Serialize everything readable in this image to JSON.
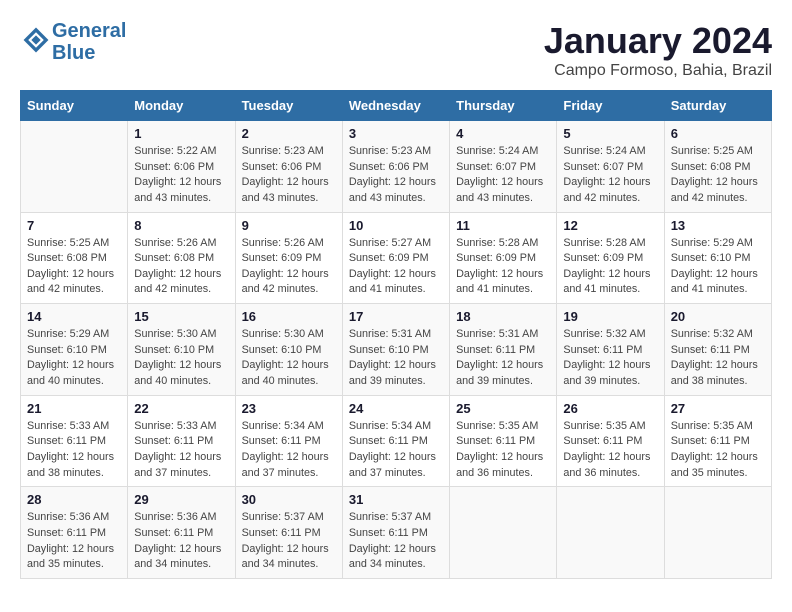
{
  "header": {
    "logo_line1": "General",
    "logo_line2": "Blue",
    "title": "January 2024",
    "subtitle": "Campo Formoso, Bahia, Brazil"
  },
  "calendar": {
    "days_of_week": [
      "Sunday",
      "Monday",
      "Tuesday",
      "Wednesday",
      "Thursday",
      "Friday",
      "Saturday"
    ],
    "weeks": [
      [
        {
          "day": "",
          "info": ""
        },
        {
          "day": "1",
          "info": "Sunrise: 5:22 AM\nSunset: 6:06 PM\nDaylight: 12 hours\nand 43 minutes."
        },
        {
          "day": "2",
          "info": "Sunrise: 5:23 AM\nSunset: 6:06 PM\nDaylight: 12 hours\nand 43 minutes."
        },
        {
          "day": "3",
          "info": "Sunrise: 5:23 AM\nSunset: 6:06 PM\nDaylight: 12 hours\nand 43 minutes."
        },
        {
          "day": "4",
          "info": "Sunrise: 5:24 AM\nSunset: 6:07 PM\nDaylight: 12 hours\nand 43 minutes."
        },
        {
          "day": "5",
          "info": "Sunrise: 5:24 AM\nSunset: 6:07 PM\nDaylight: 12 hours\nand 42 minutes."
        },
        {
          "day": "6",
          "info": "Sunrise: 5:25 AM\nSunset: 6:08 PM\nDaylight: 12 hours\nand 42 minutes."
        }
      ],
      [
        {
          "day": "7",
          "info": "Sunrise: 5:25 AM\nSunset: 6:08 PM\nDaylight: 12 hours\nand 42 minutes."
        },
        {
          "day": "8",
          "info": "Sunrise: 5:26 AM\nSunset: 6:08 PM\nDaylight: 12 hours\nand 42 minutes."
        },
        {
          "day": "9",
          "info": "Sunrise: 5:26 AM\nSunset: 6:09 PM\nDaylight: 12 hours\nand 42 minutes."
        },
        {
          "day": "10",
          "info": "Sunrise: 5:27 AM\nSunset: 6:09 PM\nDaylight: 12 hours\nand 41 minutes."
        },
        {
          "day": "11",
          "info": "Sunrise: 5:28 AM\nSunset: 6:09 PM\nDaylight: 12 hours\nand 41 minutes."
        },
        {
          "day": "12",
          "info": "Sunrise: 5:28 AM\nSunset: 6:09 PM\nDaylight: 12 hours\nand 41 minutes."
        },
        {
          "day": "13",
          "info": "Sunrise: 5:29 AM\nSunset: 6:10 PM\nDaylight: 12 hours\nand 41 minutes."
        }
      ],
      [
        {
          "day": "14",
          "info": "Sunrise: 5:29 AM\nSunset: 6:10 PM\nDaylight: 12 hours\nand 40 minutes."
        },
        {
          "day": "15",
          "info": "Sunrise: 5:30 AM\nSunset: 6:10 PM\nDaylight: 12 hours\nand 40 minutes."
        },
        {
          "day": "16",
          "info": "Sunrise: 5:30 AM\nSunset: 6:10 PM\nDaylight: 12 hours\nand 40 minutes."
        },
        {
          "day": "17",
          "info": "Sunrise: 5:31 AM\nSunset: 6:10 PM\nDaylight: 12 hours\nand 39 minutes."
        },
        {
          "day": "18",
          "info": "Sunrise: 5:31 AM\nSunset: 6:11 PM\nDaylight: 12 hours\nand 39 minutes."
        },
        {
          "day": "19",
          "info": "Sunrise: 5:32 AM\nSunset: 6:11 PM\nDaylight: 12 hours\nand 39 minutes."
        },
        {
          "day": "20",
          "info": "Sunrise: 5:32 AM\nSunset: 6:11 PM\nDaylight: 12 hours\nand 38 minutes."
        }
      ],
      [
        {
          "day": "21",
          "info": "Sunrise: 5:33 AM\nSunset: 6:11 PM\nDaylight: 12 hours\nand 38 minutes."
        },
        {
          "day": "22",
          "info": "Sunrise: 5:33 AM\nSunset: 6:11 PM\nDaylight: 12 hours\nand 37 minutes."
        },
        {
          "day": "23",
          "info": "Sunrise: 5:34 AM\nSunset: 6:11 PM\nDaylight: 12 hours\nand 37 minutes."
        },
        {
          "day": "24",
          "info": "Sunrise: 5:34 AM\nSunset: 6:11 PM\nDaylight: 12 hours\nand 37 minutes."
        },
        {
          "day": "25",
          "info": "Sunrise: 5:35 AM\nSunset: 6:11 PM\nDaylight: 12 hours\nand 36 minutes."
        },
        {
          "day": "26",
          "info": "Sunrise: 5:35 AM\nSunset: 6:11 PM\nDaylight: 12 hours\nand 36 minutes."
        },
        {
          "day": "27",
          "info": "Sunrise: 5:35 AM\nSunset: 6:11 PM\nDaylight: 12 hours\nand 35 minutes."
        }
      ],
      [
        {
          "day": "28",
          "info": "Sunrise: 5:36 AM\nSunset: 6:11 PM\nDaylight: 12 hours\nand 35 minutes."
        },
        {
          "day": "29",
          "info": "Sunrise: 5:36 AM\nSunset: 6:11 PM\nDaylight: 12 hours\nand 34 minutes."
        },
        {
          "day": "30",
          "info": "Sunrise: 5:37 AM\nSunset: 6:11 PM\nDaylight: 12 hours\nand 34 minutes."
        },
        {
          "day": "31",
          "info": "Sunrise: 5:37 AM\nSunset: 6:11 PM\nDaylight: 12 hours\nand 34 minutes."
        },
        {
          "day": "",
          "info": ""
        },
        {
          "day": "",
          "info": ""
        },
        {
          "day": "",
          "info": ""
        }
      ]
    ]
  }
}
